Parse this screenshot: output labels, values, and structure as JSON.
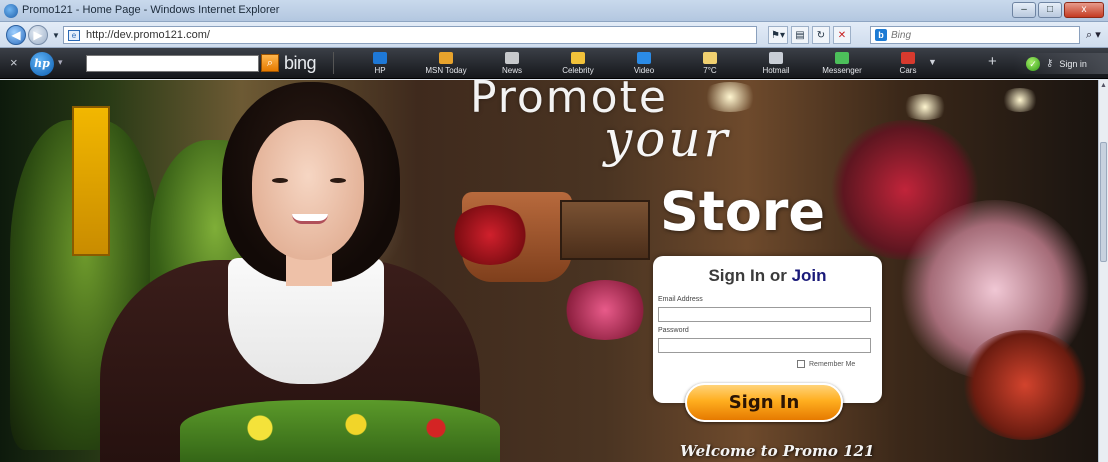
{
  "window": {
    "title": "Promo121 - Home Page - Windows Internet Explorer",
    "minimize": "–",
    "maximize": "□",
    "close": "x"
  },
  "address_bar": {
    "url": "http://dev.promo121.com/",
    "search_placeholder": "Bing",
    "search_go": "⌕ ▾"
  },
  "hp_toolbar": {
    "bing_label": "bing",
    "items": [
      {
        "label": "HP",
        "color": "#1e78d6"
      },
      {
        "label": "MSN Today",
        "color": "#e8a32c"
      },
      {
        "label": "News",
        "color": "#c7c9cc"
      },
      {
        "label": "Celebrity",
        "color": "#f2c23a"
      },
      {
        "label": "Video",
        "color": "#2b8be6"
      },
      {
        "label": "7°C",
        "color": "#f0d070"
      },
      {
        "label": "Hotmail",
        "color": "#c9ced6"
      },
      {
        "label": "Messenger",
        "color": "#4cbf5a"
      },
      {
        "label": "Cars",
        "color": "#d73a2e"
      }
    ],
    "signin_label": "Sign in"
  },
  "hero": {
    "line1": "Promote",
    "line2": "your",
    "line3": "Store",
    "welcome": "Welcome to Promo 121"
  },
  "signin_card": {
    "title_prefix": "Sign In or ",
    "title_join": "Join",
    "email_label": "Email Address",
    "email_value": "",
    "password_label": "Password",
    "password_value": "",
    "remember_label": "Remember Me",
    "button_label": "Sign In"
  }
}
